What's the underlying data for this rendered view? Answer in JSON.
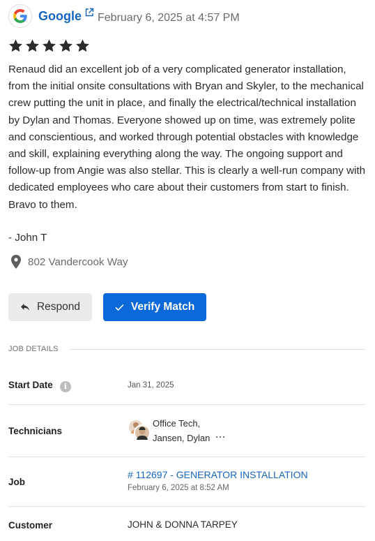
{
  "review": {
    "source": "Google",
    "date": "February 6, 2025 at 4:57 PM",
    "rating": 5,
    "text": "Renaud did an excellent job of a very complicated generator installation, from the initial onsite consultations with Bryan and Skyler, to the mechanical crew putting the unit in place, and finally the electrical/technical installation by Dylan and Thomas. Everyone showed up on time, was extremely polite and conscientious, and worked through potential obstacles with knowledge and skill, explaining everything along the way. The ongoing support and follow-up from Angie was also stellar. This is clearly a well-run company with dedicated employees who care about their customers from start to finish. Bravo to them.",
    "author": "- John T",
    "location": "802 Vandercook Way"
  },
  "actions": {
    "respond_label": "Respond",
    "verify_label": "Verify Match"
  },
  "job_details": {
    "section_title": "JOB DETAILS",
    "start_date_label": "Start Date",
    "start_date": "Jan 31, 2025",
    "technicians_label": "Technicians",
    "technicians_line1": "Office Tech,",
    "technicians_line2": "Jansen, Dylan",
    "more_label": "···",
    "job_label": "Job",
    "job_link": "# 112697 - GENERATOR INSTALLATION",
    "job_date": "February 6, 2025 at 8:52 AM",
    "customer_label": "Customer",
    "customer": "JOHN & DONNA TARPEY"
  },
  "colors": {
    "brand_blue": "#0b68d8",
    "link_blue": "#1565c0",
    "star": "#2b2b2b"
  },
  "icons": [
    "google-logo",
    "external-link-icon",
    "star-icon",
    "map-pin-icon",
    "reply-icon",
    "check-icon",
    "info-icon",
    "more-icon"
  ]
}
